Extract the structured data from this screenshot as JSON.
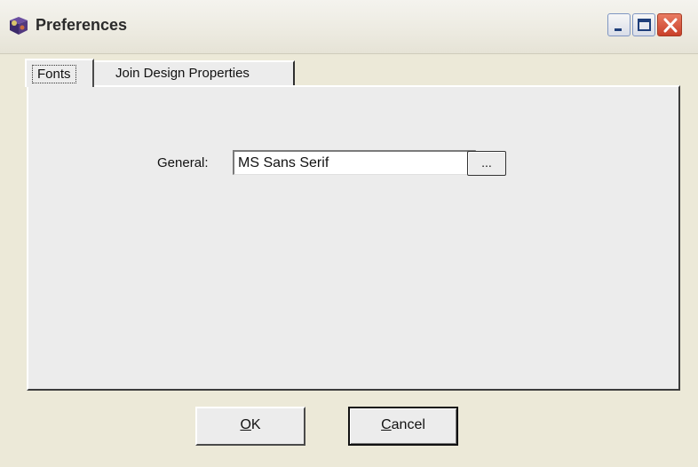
{
  "window": {
    "title": "Preferences",
    "icon": "gear-app-icon",
    "controls": {
      "minimize": "minimize-icon",
      "maximize": "maximize-icon",
      "close": "close-icon"
    }
  },
  "tabs": [
    {
      "label": "Fonts",
      "active": true
    },
    {
      "label": "Join Design Properties",
      "active": false
    }
  ],
  "fonts_tab": {
    "general_label": "General:",
    "general_value": "MS Sans Serif",
    "browse_label": "..."
  },
  "buttons": {
    "ok": {
      "mnemonic": "O",
      "rest": "K"
    },
    "cancel": {
      "mnemonic": "C",
      "rest": "ancel"
    }
  },
  "colors": {
    "dialog_bg": "#ece9d8",
    "close_button": "#c9402a"
  }
}
